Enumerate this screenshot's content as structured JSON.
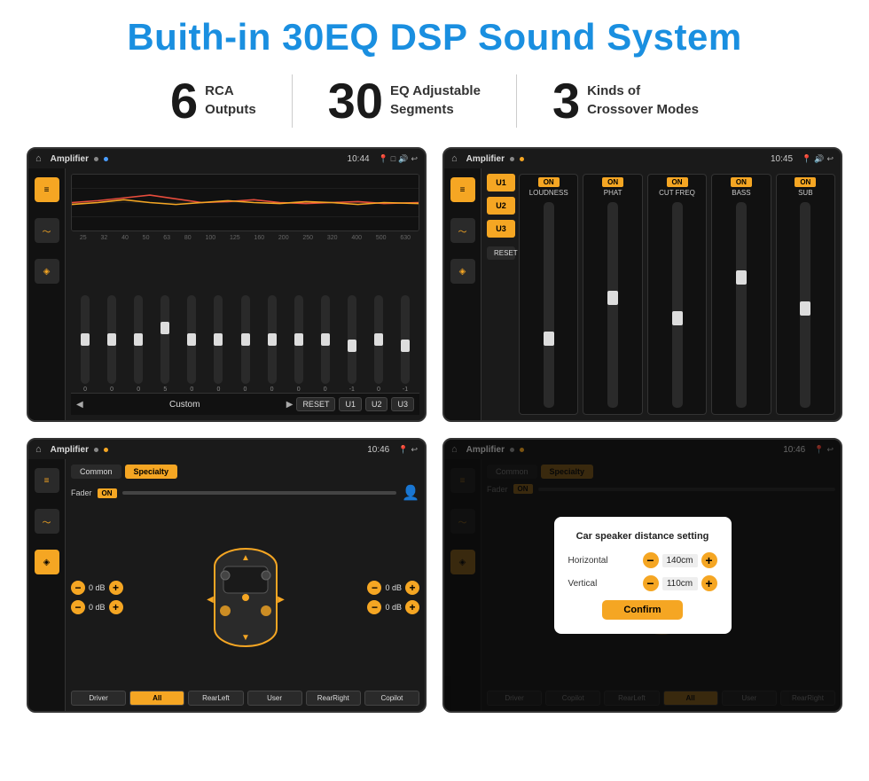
{
  "page": {
    "title": "Buith-in 30EQ DSP Sound System",
    "stats": [
      {
        "number": "6",
        "label": "RCA\nOutputs"
      },
      {
        "number": "30",
        "label": "EQ Adjustable\nSegments"
      },
      {
        "number": "3",
        "label": "Kinds of\nCrossover Modes"
      }
    ]
  },
  "screen1": {
    "app": "Amplifier",
    "time": "10:44",
    "freqs": [
      "25",
      "32",
      "40",
      "50",
      "63",
      "80",
      "100",
      "125",
      "160",
      "200",
      "250",
      "320",
      "400",
      "500",
      "630"
    ],
    "sliders": [
      0,
      0,
      0,
      5,
      0,
      0,
      0,
      0,
      0,
      0,
      -1,
      0,
      -1
    ],
    "preset": "Custom",
    "buttons": [
      "RESET",
      "U1",
      "U2",
      "U3"
    ]
  },
  "screen2": {
    "app": "Amplifier",
    "time": "10:45",
    "presets": [
      "U1",
      "U2",
      "U3"
    ],
    "channels": [
      {
        "toggle": "ON",
        "label": "LOUDNESS"
      },
      {
        "toggle": "ON",
        "label": "PHAT"
      },
      {
        "toggle": "ON",
        "label": "CUT FREQ"
      },
      {
        "toggle": "ON",
        "label": "BASS"
      },
      {
        "toggle": "ON",
        "label": "SUB"
      }
    ],
    "reset_label": "RESET"
  },
  "screen3": {
    "app": "Amplifier",
    "time": "10:46",
    "tabs": [
      "Common",
      "Specialty"
    ],
    "fader_label": "Fader",
    "fader_on": "ON",
    "left_vols": [
      "0 dB",
      "0 dB"
    ],
    "right_vols": [
      "0 dB",
      "0 dB"
    ],
    "bottom_btns": [
      "Driver",
      "All",
      "RearLeft",
      "User",
      "RearRight",
      "Copilot"
    ]
  },
  "screen4": {
    "app": "Amplifier",
    "time": "10:46",
    "tabs": [
      "Common",
      "Specialty"
    ],
    "fader_label": "Fader",
    "fader_on": "ON",
    "dialog": {
      "title": "Car speaker distance setting",
      "horizontal_label": "Horizontal",
      "horizontal_value": "140cm",
      "vertical_label": "Vertical",
      "vertical_value": "110cm",
      "confirm_label": "Confirm",
      "minus_label": "−",
      "plus_label": "+"
    },
    "bottom_btns": [
      "Driver",
      "Copilot",
      "RearLeft",
      "All",
      "User",
      "RearRight"
    ]
  },
  "icons": {
    "home": "⌂",
    "settings_eq": "≡",
    "waveform": "〜",
    "speaker": "🔊",
    "play": "▶",
    "prev": "◀",
    "next": "⏭",
    "reset": "↺",
    "person": "👤"
  }
}
